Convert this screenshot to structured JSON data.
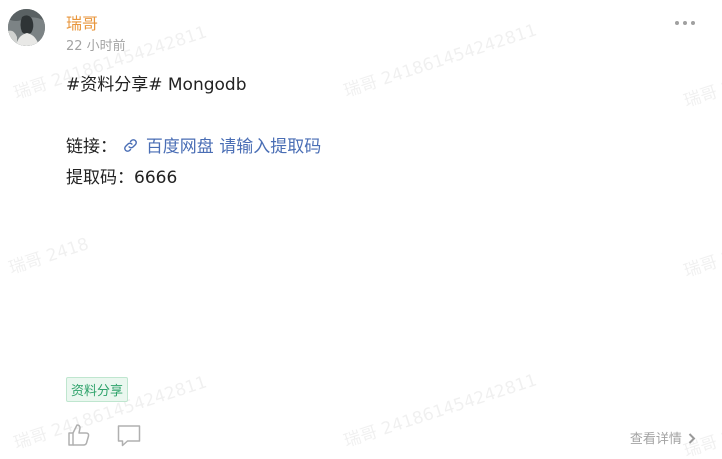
{
  "post": {
    "author": "瑞哥",
    "time": "22 小时前",
    "more_icon": "more-icon",
    "title": "#资料分享# Mongodb",
    "link_label": "链接：",
    "link_text": "百度网盘 请输入提取码",
    "code_label": "提取码：",
    "code_value": "6666",
    "tag": "资料分享",
    "detail_label": "查看详情"
  },
  "watermark": {
    "text_full": "瑞哥 241861454242811",
    "text_a": "瑞哥 241861454242811",
    "text_b": "瑞哥 2",
    "text_c": "瑞哥 2418"
  },
  "colors": {
    "author": "#e8963c",
    "link": "#4a6eb5",
    "tag_text": "#2fa36b",
    "tag_bg": "#eaf7ef",
    "muted": "#a3a3a3"
  }
}
